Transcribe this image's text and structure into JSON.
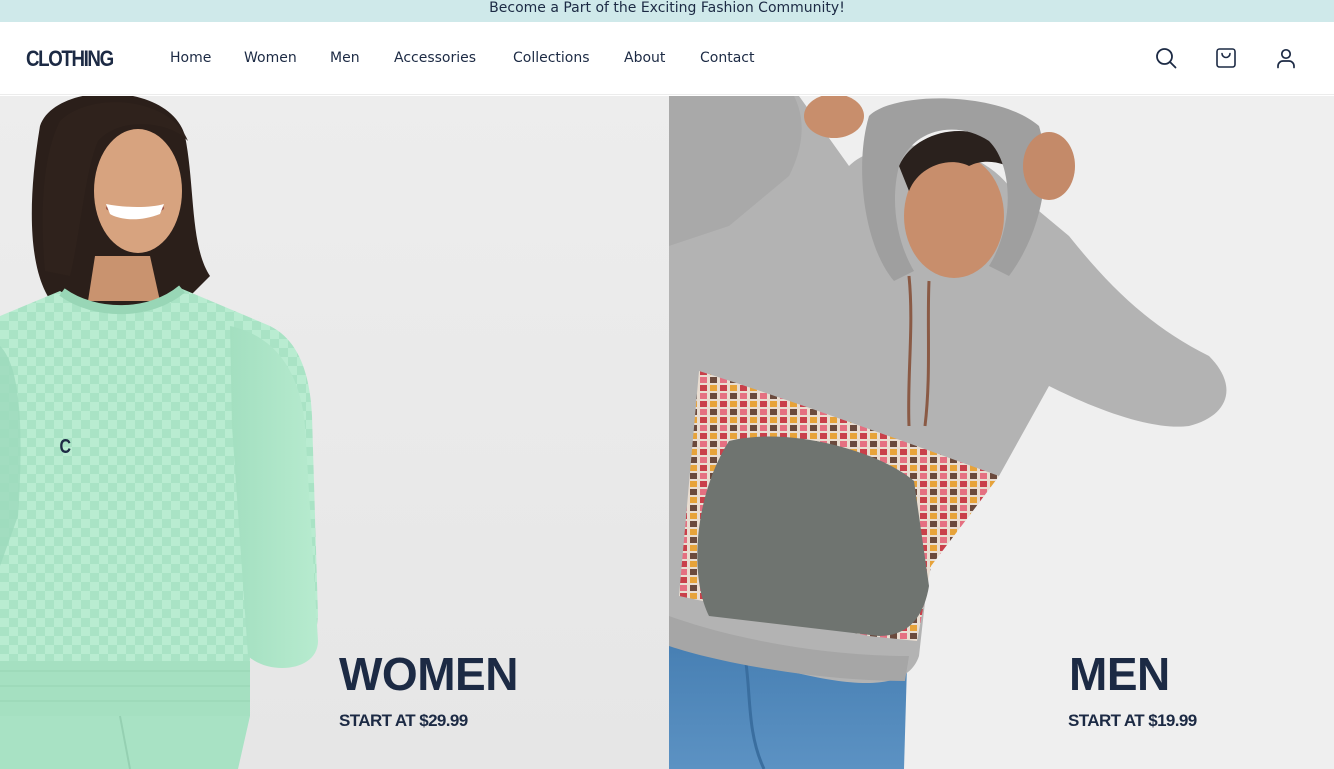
{
  "announcement": "Become a Part of the Exciting Fashion Community!",
  "brand": "CLOTHING",
  "nav": [
    {
      "label": "Home"
    },
    {
      "label": "Women"
    },
    {
      "label": "Men"
    },
    {
      "label": "Accessories"
    },
    {
      "label": "Collections"
    },
    {
      "label": "About"
    },
    {
      "label": "Contact"
    }
  ],
  "header_icons": [
    "search-icon",
    "shopping-bag-icon",
    "user-icon"
  ],
  "hero": {
    "women": {
      "title": "WOMEN",
      "price": "START AT $29.99",
      "shirt_letter": "C"
    },
    "men": {
      "title": "MEN",
      "price": "START AT $19.99"
    }
  },
  "colors": {
    "navy": "#1c2a44",
    "announcement_bg": "#cfe9ea",
    "mint": "#a8e2c4",
    "hoodie_gray": "#b3b3b3",
    "pocket_gray": "#6f7470",
    "denim": "#4a7fb1"
  }
}
